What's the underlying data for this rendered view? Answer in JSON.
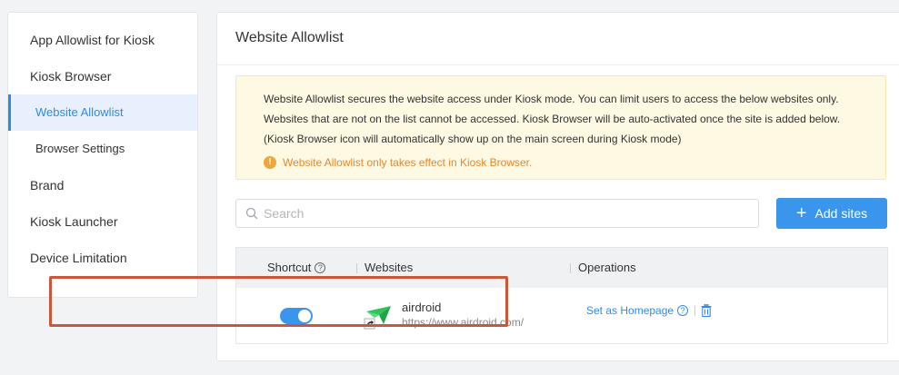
{
  "sidebar": {
    "items": [
      {
        "label": "App Allowlist for Kiosk"
      },
      {
        "label": "Kiosk Browser"
      },
      {
        "label": "Website Allowlist"
      },
      {
        "label": "Browser Settings"
      },
      {
        "label": "Brand"
      },
      {
        "label": "Kiosk Launcher"
      },
      {
        "label": "Device Limitation"
      }
    ],
    "active_index": 2
  },
  "main": {
    "title": "Website Allowlist",
    "notice": {
      "line1": "Website Allowlist secures the website access under Kiosk mode. You can limit users to access the below websites only.",
      "line2": "Websites that are not on the list cannot be accessed. Kiosk Browser will be auto-activated once the site is added below.",
      "line3": "(Kiosk Browser icon will automatically show up on the main screen during Kiosk mode)",
      "warning": "Website Allowlist only takes effect in Kiosk Browser."
    },
    "search": {
      "placeholder": "Search",
      "value": ""
    },
    "add_button": "Add sites",
    "table": {
      "headers": [
        "Shortcut",
        "Websites",
        "Operations"
      ],
      "rows": [
        {
          "shortcut_on": true,
          "name": "airdroid",
          "url": "https://www.airdroid.com/",
          "set_homepage": "Set as Homepage"
        }
      ]
    }
  },
  "colors": {
    "accent": "#2e8ce6",
    "button": "#3a95ec",
    "warning": "#e8882a",
    "highlight": "#c9573a"
  }
}
